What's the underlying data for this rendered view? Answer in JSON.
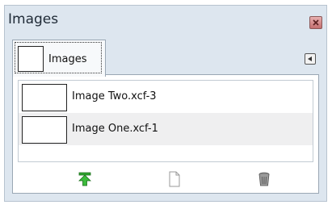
{
  "window": {
    "title": "Images",
    "close_icon": "close-icon"
  },
  "tab": {
    "label": "Images",
    "menu_icon": "tab-menu-arrow-icon"
  },
  "images": [
    {
      "name": "Image Two.xcf-3"
    },
    {
      "name": "Image One.xcf-1"
    }
  ],
  "toolbar": {
    "buttons": [
      {
        "icon": "raise-view-icon",
        "color": "#2fa52f"
      },
      {
        "icon": "new-display-icon",
        "color": "#9a9a9a"
      },
      {
        "icon": "delete-icon",
        "color": "#6f6f6f"
      }
    ]
  }
}
